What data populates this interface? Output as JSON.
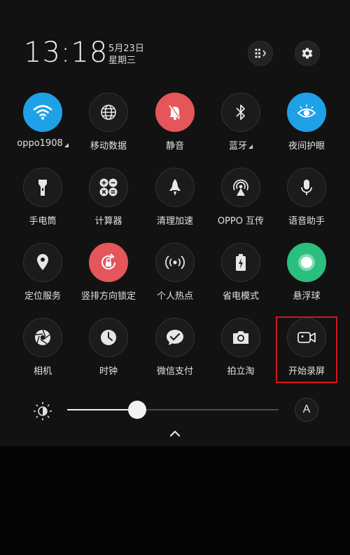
{
  "status": {
    "time": "13:18",
    "date": "5月23日",
    "weekday": "星期三"
  },
  "top_buttons": [
    {
      "name": "edit-tiles-icon"
    },
    {
      "name": "gear-icon"
    }
  ],
  "tiles": [
    {
      "label": "oppo1908",
      "icon": "wifi-icon",
      "state": "on",
      "color": "#1fa1e7",
      "has_arrow": true
    },
    {
      "label": "移动数据",
      "icon": "globe-icon",
      "state": "off"
    },
    {
      "label": "静音",
      "icon": "mute-bell-icon",
      "state": "on",
      "color": "#e4565a"
    },
    {
      "label": "蓝牙",
      "icon": "bluetooth-icon",
      "state": "off",
      "has_arrow": true
    },
    {
      "label": "夜间护眼",
      "icon": "eye-icon",
      "state": "on",
      "color": "#1fa1e7"
    },
    {
      "label": "手电筒",
      "icon": "flashlight-icon",
      "state": "off"
    },
    {
      "label": "计算器",
      "icon": "calculator-icon",
      "state": "off"
    },
    {
      "label": "清理加速",
      "icon": "rocket-icon",
      "state": "off"
    },
    {
      "label": "OPPO 互传",
      "icon": "share-beam-icon",
      "state": "off"
    },
    {
      "label": "语音助手",
      "icon": "microphone-icon",
      "state": "off"
    },
    {
      "label": "定位服务",
      "icon": "location-pin-icon",
      "state": "off"
    },
    {
      "label": "竖排方向锁定",
      "icon": "rotation-lock-icon",
      "state": "on",
      "color": "#e4565a"
    },
    {
      "label": "个人热点",
      "icon": "hotspot-icon",
      "state": "off"
    },
    {
      "label": "省电模式",
      "icon": "battery-saver-icon",
      "state": "off"
    },
    {
      "label": "悬浮球",
      "icon": "floating-ball-icon",
      "state": "on",
      "color": "#2bbf7e"
    },
    {
      "label": "相机",
      "icon": "aperture-icon",
      "state": "off"
    },
    {
      "label": "时钟",
      "icon": "clock-icon",
      "state": "off"
    },
    {
      "label": "微信支付",
      "icon": "wechat-pay-icon",
      "state": "off"
    },
    {
      "label": "拍立淘",
      "icon": "camera-icon",
      "state": "off"
    },
    {
      "label": "开始录屏",
      "icon": "video-record-icon",
      "state": "off",
      "highlighted": true
    }
  ],
  "brightness": {
    "level": 0.33,
    "auto_label": "A",
    "icon": "brightness-icon"
  },
  "collapse_icon": "chevron-up-icon"
}
